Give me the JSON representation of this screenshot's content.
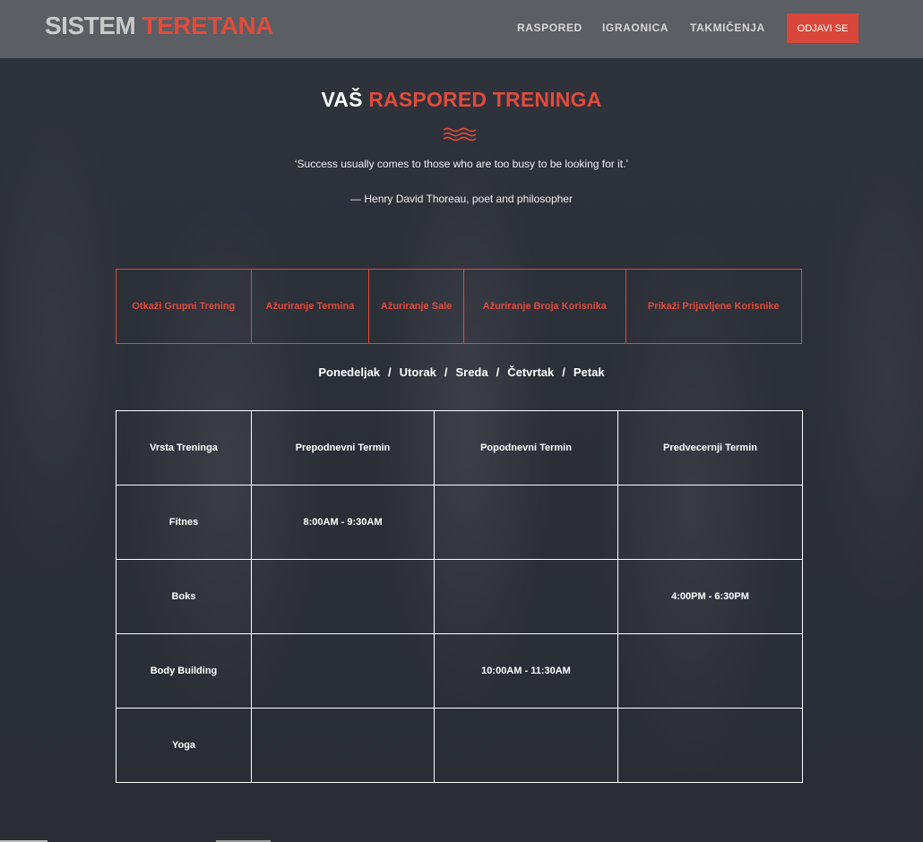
{
  "brand": {
    "part1": "SISTEM",
    "part2": "TERETANA"
  },
  "nav": {
    "items": [
      "RASPORED",
      "IGRAONICA",
      "TAKMIČENJA"
    ],
    "logout": "ODJAVI SE"
  },
  "heading": {
    "part1": "VAŠ",
    "part2": "RASPORED TRENINGA"
  },
  "quote": {
    "text": "‘Success usually comes to those who are too busy to be looking for it.’",
    "author": "— Henry David Thoreau, poet and philosopher"
  },
  "actions": [
    "Otkaži Grupni Trening",
    "Ažuriranje Termina",
    "Ažuriranje Sale",
    "Ažuriranje Broja Korisnika",
    "Prikaži Prijavljene Korisnike"
  ],
  "days": [
    "Ponedeljak",
    "Utorak",
    "Sreda",
    "Četvrtak",
    "Petak"
  ],
  "day_separator": "/",
  "schedule": {
    "headers": [
      "Vrsta Treninga",
      "Prepodnevni Termin",
      "Popodnevni Termin",
      "Predvecernji Termin"
    ],
    "rows": [
      [
        "Fitnes",
        "8:00AM - 9:30AM",
        "",
        ""
      ],
      [
        "Boks",
        "",
        "",
        "4:00PM - 6:30PM"
      ],
      [
        "Body Building",
        "",
        "10:00AM - 11:30AM",
        ""
      ],
      [
        "Yoga",
        "",
        "",
        ""
      ]
    ]
  },
  "colors": {
    "accent": "#e04b3c",
    "navbar": "#5b5e63",
    "background": "#2b2f38"
  }
}
